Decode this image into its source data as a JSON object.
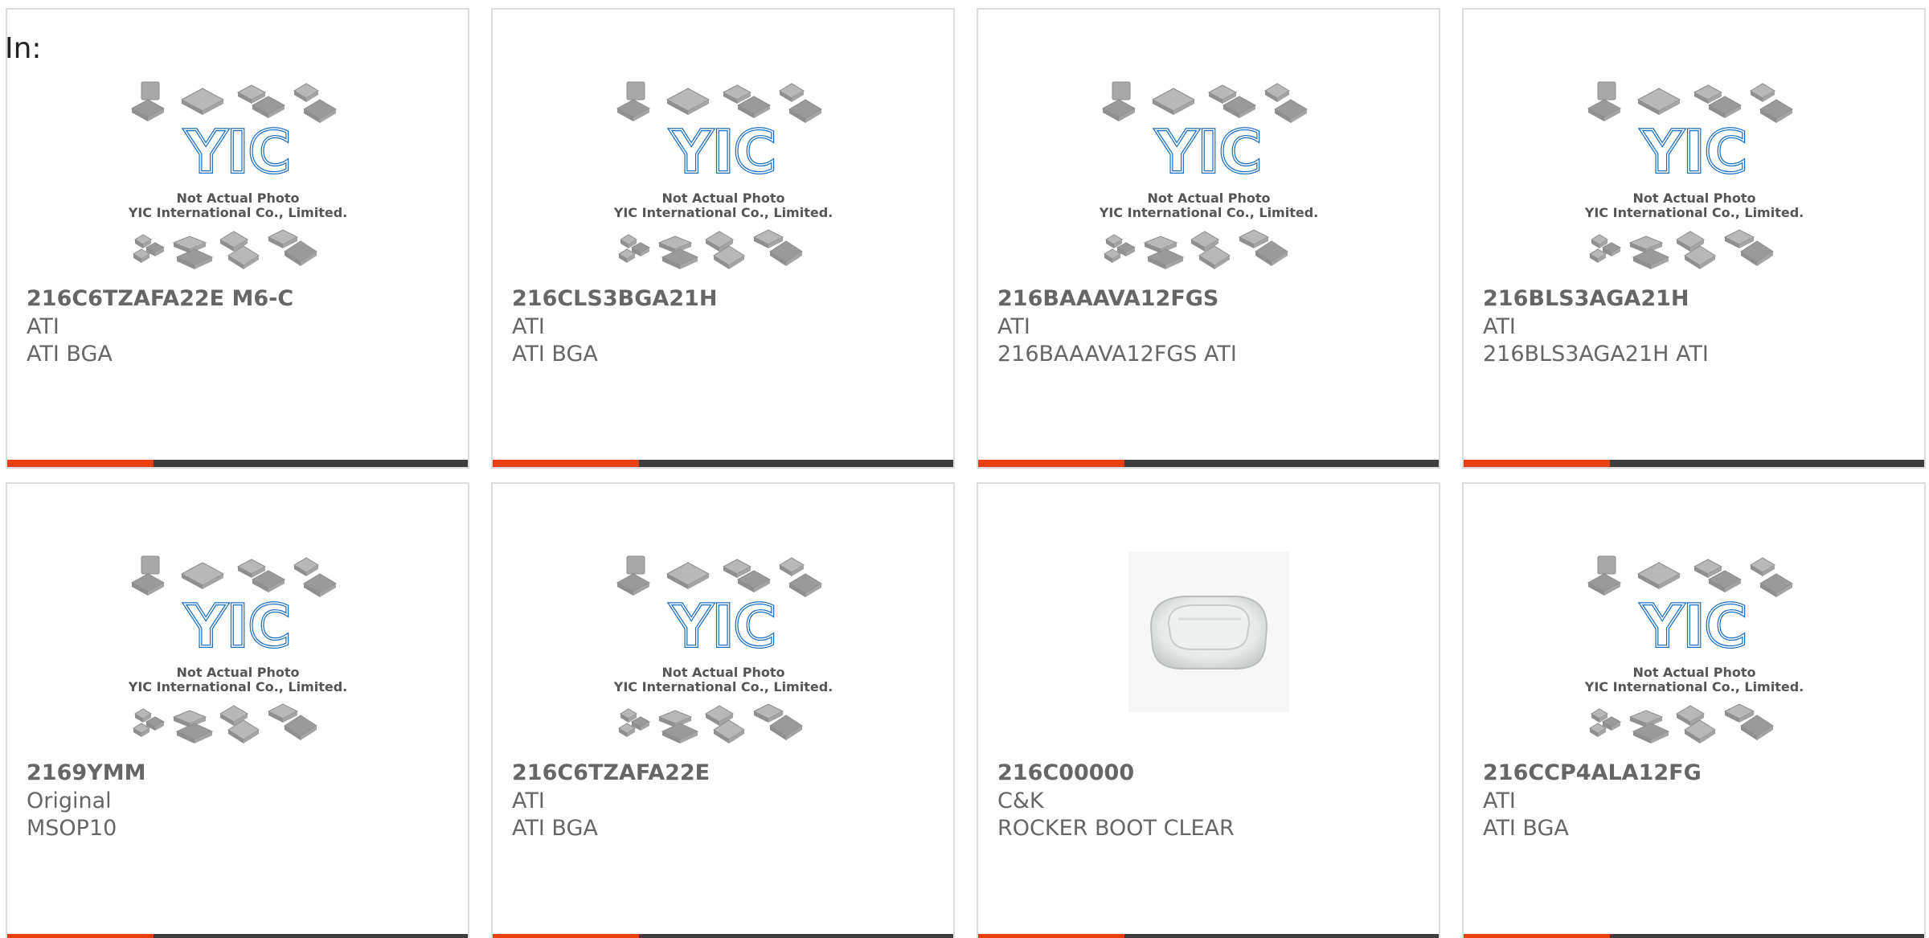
{
  "filter_label": "In:",
  "placeholder": {
    "logo": "YIC",
    "line1": "Not Actual Photo",
    "line2": "YIC International Co., Limited."
  },
  "colors": {
    "accent": "#e8400c",
    "bar": "#3d3d3d",
    "logo_blue": "#1a6fc2",
    "text": "#666666"
  },
  "products": [
    {
      "part": "216C6TZAFA22E M6-C",
      "brand": "ATI",
      "desc": "ATI BGA",
      "image": "placeholder-image"
    },
    {
      "part": "216CLS3BGA21H",
      "brand": "ATI",
      "desc": "ATI BGA",
      "image": "placeholder-image"
    },
    {
      "part": "216BAAAVA12FGS",
      "brand": "ATI",
      "desc": "216BAAAVA12FGS ATI",
      "image": "placeholder-image"
    },
    {
      "part": "216BLS3AGA21H",
      "brand": "ATI",
      "desc": "216BLS3AGA21H ATI",
      "image": "placeholder-image"
    },
    {
      "part": "2169YMM",
      "brand": "Original",
      "desc": "MSOP10",
      "image": "placeholder-image"
    },
    {
      "part": "216C6TZAFA22E",
      "brand": "ATI",
      "desc": "ATI BGA",
      "image": "placeholder-image"
    },
    {
      "part": "216C00000",
      "brand": "C&K",
      "desc": "ROCKER BOOT CLEAR",
      "image": "rocker-boot-photo"
    },
    {
      "part": "216CCP4ALA12FG",
      "brand": "ATI",
      "desc": "ATI BGA",
      "image": "placeholder-image"
    }
  ]
}
